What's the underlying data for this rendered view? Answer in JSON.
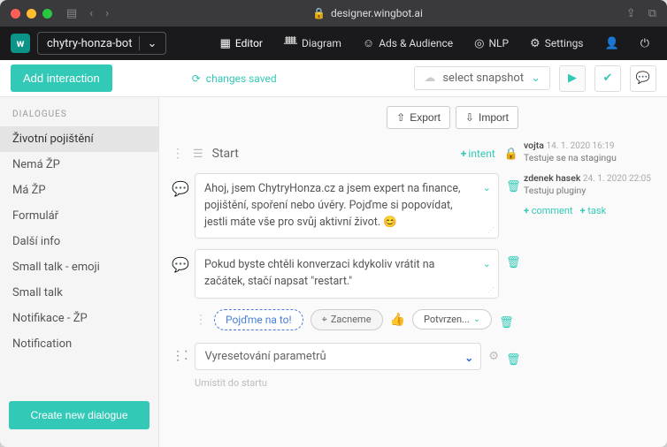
{
  "browser": {
    "url": "designer.wingbot.ai"
  },
  "topnav": {
    "bot": "chytry-honza-bot",
    "items": {
      "editor": "Editor",
      "diagram": "Diagram",
      "ads": "Ads & Audience",
      "nlp": "NLP",
      "settings": "Settings"
    }
  },
  "toolbar": {
    "add": "Add interaction",
    "changes": "changes saved",
    "snapshot": "select snapshot"
  },
  "sidebar": {
    "title": "DIALOGUES",
    "items": [
      "Životní pojištění",
      "Nemá ŽP",
      "Má ŽP",
      "Formulář",
      "Další info",
      "Small talk - emoji",
      "Small talk",
      "Notifikace - ŽP",
      "Notification"
    ],
    "create": "Create new dialogue"
  },
  "main": {
    "export": "Export",
    "import": "Import",
    "start": "Start",
    "intent": "intent",
    "msg1": "Ahoj, jsem ChytryHonza.cz a jsem expert na finance, pojištění, spoření nebo úvěry. Pojďme si popovídat, jestli máte vše pro svůj aktivní život. 😊",
    "msg2": "Pokud byste chtěli konverzaci kdykoliv vrátit na začátek, stačí napsat \"restart.\"",
    "chip1": "Pojďme na to!",
    "chip2": "Zacneme",
    "chip3": "Potvrzen...",
    "reset": "Vyresetování parametrů",
    "hint": "Umístit do startu"
  },
  "comments": [
    {
      "author": "vojta",
      "date": "14. 1. 2020 16:19",
      "text": "Testuje se na stagingu"
    },
    {
      "author": "zdenek hasek",
      "date": "24. 1. 2020 22:05",
      "text": "Testuju pluginy"
    }
  ],
  "comment_actions": {
    "comment": "comment",
    "task": "task"
  }
}
